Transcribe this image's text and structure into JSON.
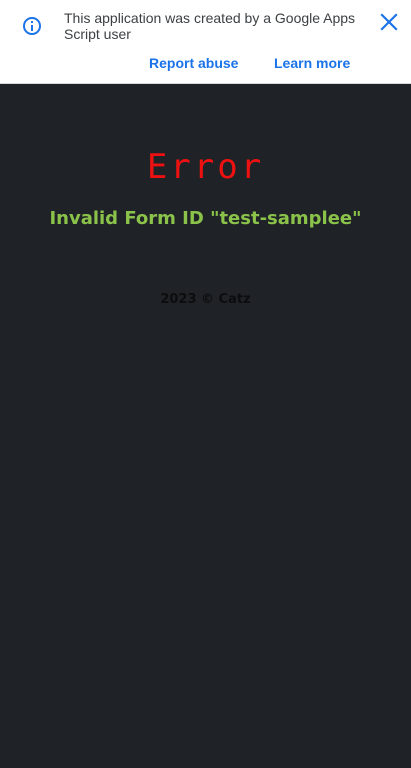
{
  "banner": {
    "message": "This application was created by a Google Apps Script user",
    "report_label": "Report abuse",
    "learn_label": "Learn more",
    "colors": {
      "link": "#1a73e8",
      "icon": "#1a73e8"
    }
  },
  "error": {
    "title": "Error",
    "message": "Invalid Form ID \"test-samplee\"",
    "colors": {
      "title": "#ee1111",
      "message": "#8bc34a"
    }
  },
  "footer": {
    "text": "2023 © Catz"
  },
  "theme": {
    "background": "#1f2226"
  }
}
